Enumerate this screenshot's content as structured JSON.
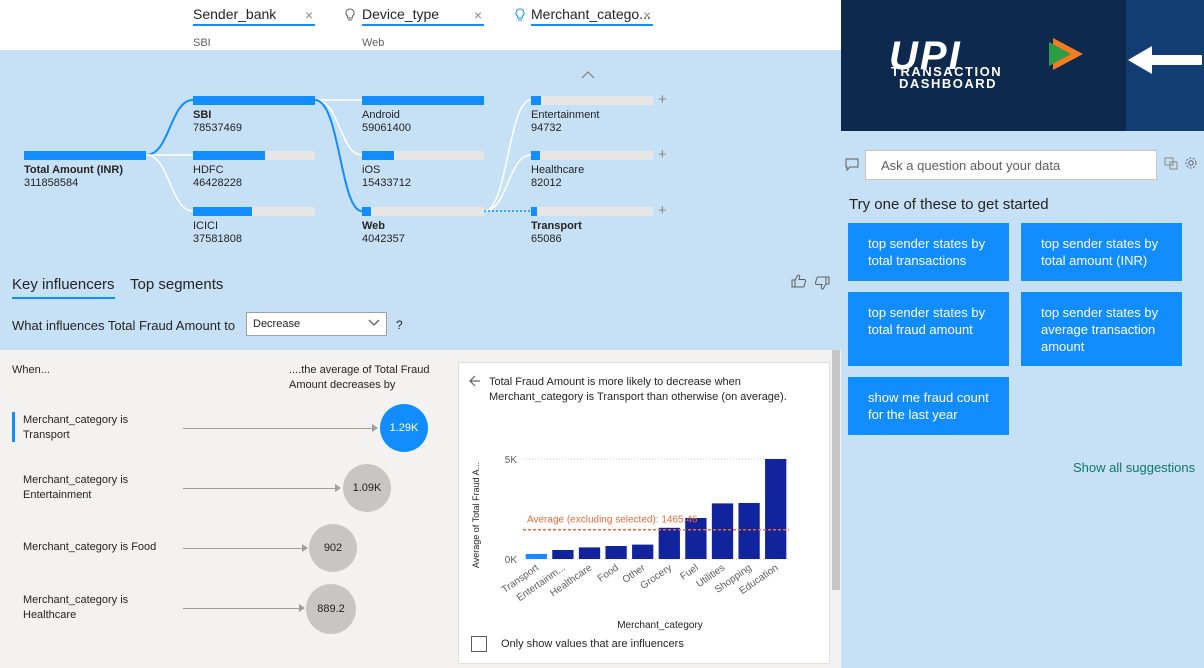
{
  "tree_header": {
    "levels": [
      {
        "name": "Sender_bank",
        "selected": "SBI"
      },
      {
        "name": "Device_type",
        "selected": "Web"
      },
      {
        "name": "Merchant_catego...",
        "selected": ""
      }
    ],
    "close_glyph": "×"
  },
  "tree": {
    "root": {
      "label": "Total Amount (INR)",
      "value": "311858584"
    },
    "banks": [
      {
        "label": "SBI",
        "value": "78537469",
        "fill": 1.0
      },
      {
        "label": "HDFC",
        "value": "46428228",
        "fill": 0.59
      },
      {
        "label": "ICICI",
        "value": "37581808",
        "fill": 0.48
      }
    ],
    "devices": [
      {
        "label": "Android",
        "value": "59061400",
        "fill": 1.0
      },
      {
        "label": "iOS",
        "value": "15433712",
        "fill": 0.26
      },
      {
        "label": "Web",
        "value": "4042357",
        "fill": 0.07
      }
    ],
    "categories": [
      {
        "label": "Entertainment",
        "value": "94732",
        "fill": 0.08
      },
      {
        "label": "Healthcare",
        "value": "82012",
        "fill": 0.07
      },
      {
        "label": "Transport",
        "value": "65086",
        "fill": 0.05
      }
    ],
    "plus_glyph": "+"
  },
  "key_influencers": {
    "tabs": [
      "Key influencers",
      "Top segments"
    ],
    "question": "What influences Total Fraud Amount to",
    "select_value": "Decrease",
    "qmark": "?",
    "col_when": "When...",
    "col_avg": "....the average of Total Fraud Amount decreases by",
    "rows": [
      {
        "label": "Merchant_category is Transport",
        "value": "1.29K"
      },
      {
        "label": "Merchant_category is Entertainment",
        "value": "1.09K"
      },
      {
        "label": "Merchant_category is Food",
        "value": "902"
      },
      {
        "label": "Merchant_category is Healthcare",
        "value": "889.2"
      }
    ],
    "detail_text": "Total Fraud Amount is more likely to decrease when Merchant_category is Transport than otherwise (on average).",
    "checkbox_label": "Only show values that are influencers"
  },
  "chart_data": {
    "type": "bar",
    "categories": [
      "Transport",
      "Entertainm...",
      "Healthcare",
      "Food",
      "Other",
      "Grocery",
      "Fuel",
      "Utilities",
      "Shopping",
      "Education"
    ],
    "values": [
      250,
      450,
      580,
      650,
      720,
      1560,
      2050,
      2780,
      2800,
      5000
    ],
    "highlight_index": 0,
    "ylabel": "Average of Total Fraud A...",
    "xlabel": "Merchant_category",
    "yticks": [
      "0K",
      "5K"
    ],
    "ylim": [
      0,
      5000
    ],
    "reference_line": {
      "label": "Average (excluding selected): 1465.46",
      "value": 1465.46
    },
    "colors": {
      "highlight": "#118dff",
      "bar": "#12239e",
      "ref": "#e66c37"
    }
  },
  "right_panel": {
    "banner_title": "UPI",
    "banner_sub1": "TRANSACTION",
    "banner_sub2": "DASHBOARD",
    "qa_placeholder": "Ask a question about your data",
    "try_label": "Try one of these to get started",
    "suggestions": [
      "top sender states by total transactions",
      "top sender states by total amount (INR)",
      "top sender states by total fraud amount",
      "top sender states by average transaction amount",
      "show me fraud count for the last year"
    ],
    "show_all": "Show all suggestions"
  }
}
